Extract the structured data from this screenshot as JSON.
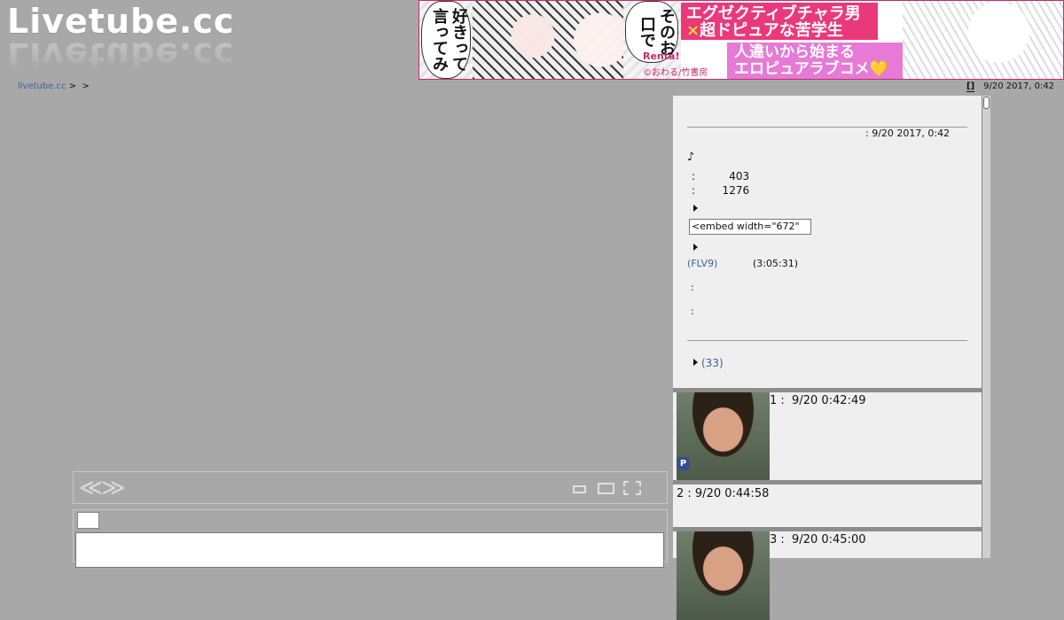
{
  "logo": {
    "text": "Livetube.cc"
  },
  "ad": {
    "bubble_left": "好きって言ってみ",
    "bubble_right": "そのお口で",
    "line1": "エグゼクティブチャラ男",
    "line2_mark": "×",
    "line2": "超ドピュアな苦学生",
    "brand": "Renta!",
    "copyright": "©おわる/竹書房",
    "line3": "人違いから始まる",
    "line4": "エロピュアラブコメ💛"
  },
  "breadcrumb": {
    "home": "livetube.cc",
    "sep1": ">",
    "sep2": ">"
  },
  "top": {
    "icon_label": "[]",
    "date": "9/20 2017, 0:42"
  },
  "player": {
    "prev_next": "≪≫"
  },
  "info": {
    "date_line": ": 9/20 2017, 0:42",
    "note": "♪",
    "views_line": ":          403",
    "total_line": ":        1276",
    "embed_value": "<embed width=\"672\"",
    "flv_link": "(FLV9)",
    "duration": "(3:05:31)",
    "field1": ":",
    "field2": ":",
    "comments_link": "(33)"
  },
  "comments": [
    {
      "header": "1 :  9/20 0:42:49",
      "badge": "P"
    },
    {
      "header": "2 : 9/20 0:44:58"
    },
    {
      "header": "3 :  9/20 0:45:00"
    }
  ],
  "colors": {
    "background": "#a8a8a8",
    "panel": "#efefef",
    "link": "#3b5fa0",
    "ad_pink": "#e9397a"
  }
}
